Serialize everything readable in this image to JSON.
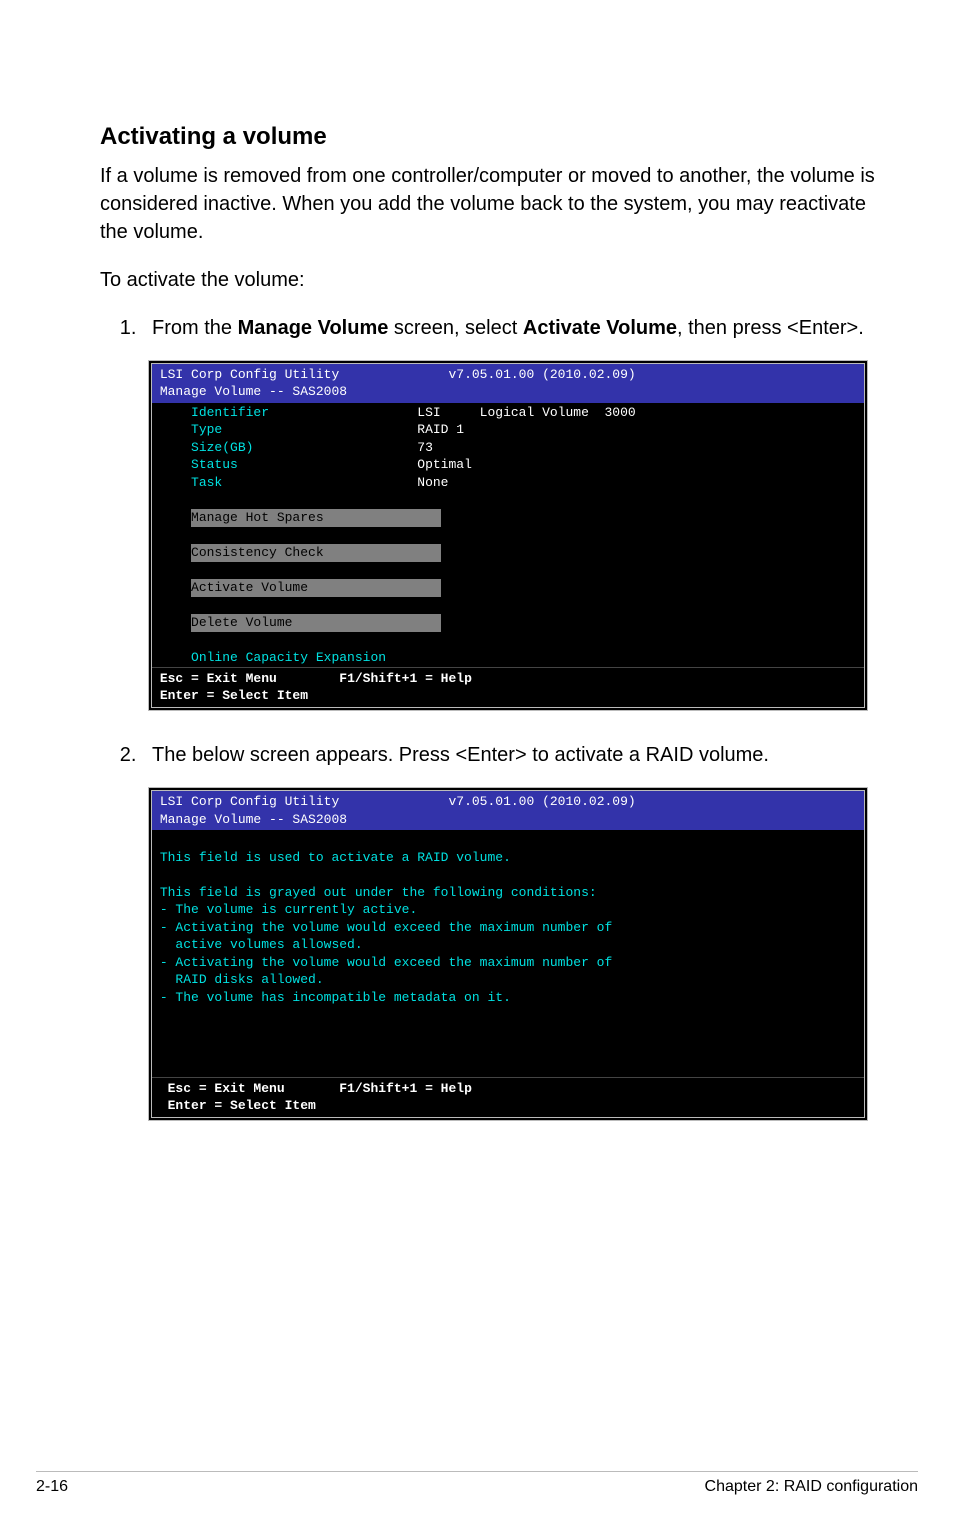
{
  "heading": "Activating a volume",
  "intro": "If a volume is removed from one controller/computer or moved to another, the volume is considered inactive. When you add the volume back to the system, you may reactivate the volume.",
  "para2": "To activate the volume:",
  "step1": {
    "lead": "From the ",
    "bold1": "Manage Volume",
    "mid": " screen, select ",
    "bold2": "Activate Volume",
    "tail": ", then press <Enter>."
  },
  "screen1": {
    "title_left": "LSI Corp Config Utility",
    "title_right": "v7.05.01.00 (2010.02.09)",
    "subtitle": "Manage Volume -- SAS2008",
    "rows": {
      "identifier": {
        "label": "Identifier",
        "value": "LSI     Logical Volume  3000"
      },
      "type": {
        "label": "Type",
        "value": "RAID 1"
      },
      "size": {
        "label": "Size(GB)",
        "value": "73"
      },
      "status": {
        "label": "Status",
        "value": "Optimal"
      },
      "task": {
        "label": "Task",
        "value": "None"
      }
    },
    "menu": {
      "hot": "Manage Hot Spares",
      "cons": "Consistency Check",
      "act": "Activate Volume",
      "del": "Delete Volume",
      "online": "Online Capacity Expansion"
    },
    "foot1": "Esc = Exit Menu",
    "foot2": "F1/Shift+1 = Help",
    "foot3": "Enter = Select Item"
  },
  "step2": "The below screen appears. Press <Enter> to activate a RAID volume.",
  "screen2": {
    "title_left": "LSI Corp Config Utility",
    "title_right": "v7.05.01.00 (2010.02.09)",
    "subtitle": "Manage Volume -- SAS2008",
    "line1": "This field is used to activate a RAID volume.",
    "line2": "This field is grayed out under the following conditions:",
    "b1": "- The volume is currently active.",
    "b2": "- Activating the volume would exceed the maximum number of",
    "b2b": "  active volumes allowsed.",
    "b3": "- Activating the volume would exceed the maximum number of",
    "b3b": "  RAID disks allowed.",
    "b4": "- The volume has incompatible metadata on it.",
    "foot1": "Esc = Exit Menu",
    "foot2": "F1/Shift+1 = Help",
    "foot3": "Enter = Select Item"
  },
  "footer": {
    "left": "2-16",
    "right": "Chapter 2: RAID configuration"
  }
}
